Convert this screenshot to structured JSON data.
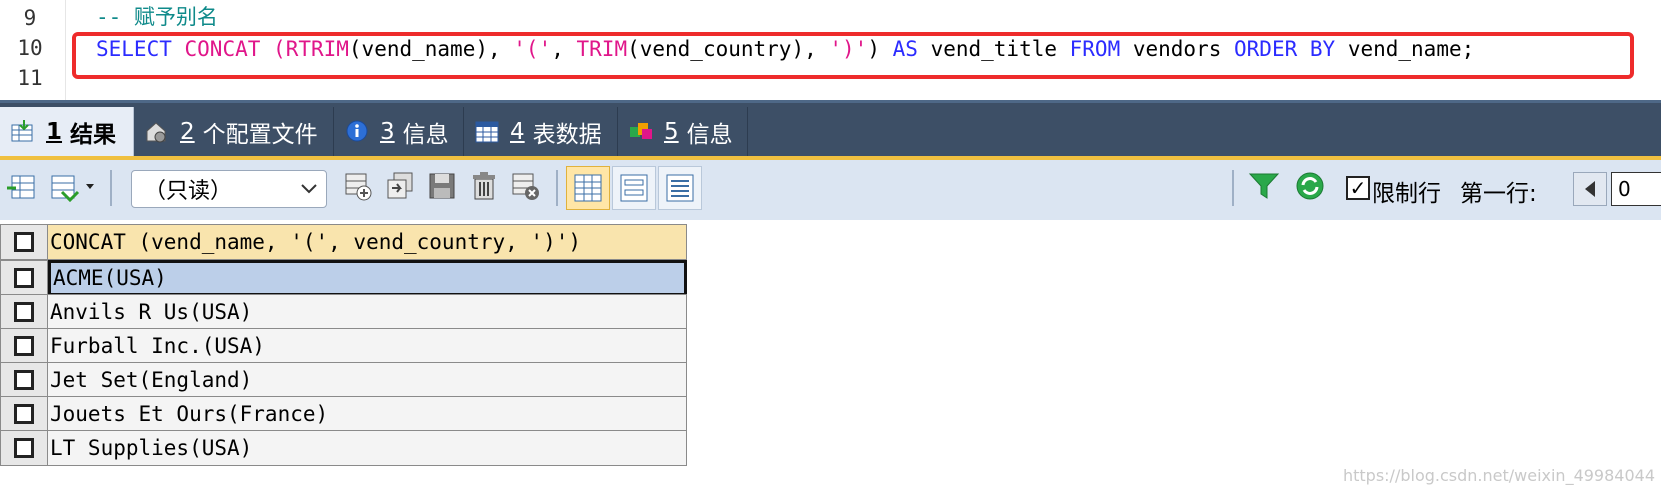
{
  "editor": {
    "line_numbers": [
      "9",
      "10",
      "11"
    ],
    "comment": "-- 赋予别名",
    "tokens": [
      {
        "t": "SELECT",
        "c": "kw"
      },
      {
        "t": " ",
        "c": "plain"
      },
      {
        "t": "CONCAT",
        "c": "fn"
      },
      {
        "t": " ",
        "c": "plain"
      },
      {
        "t": "(",
        "c": "str"
      },
      {
        "t": "RTRIM",
        "c": "fn"
      },
      {
        "t": "(vend_name), ",
        "c": "plain"
      },
      {
        "t": "'('",
        "c": "str"
      },
      {
        "t": ", ",
        "c": "plain"
      },
      {
        "t": "TRIM",
        "c": "fn"
      },
      {
        "t": "(vend_country), ",
        "c": "plain"
      },
      {
        "t": "')'",
        "c": "str"
      },
      {
        "t": ") ",
        "c": "plain"
      },
      {
        "t": "AS",
        "c": "kw"
      },
      {
        "t": " vend_title ",
        "c": "plain"
      },
      {
        "t": "FROM",
        "c": "kw"
      },
      {
        "t": " vendors ",
        "c": "plain"
      },
      {
        "t": "ORDER BY",
        "c": "kw"
      },
      {
        "t": " vend_name;",
        "c": "plain"
      }
    ],
    "highlight_color": "#ee2b2b"
  },
  "tabs": [
    {
      "num": "1",
      "label": "结果",
      "icon": "result-grid-icon",
      "active": true
    },
    {
      "num": "2",
      "label": "个配置文件",
      "icon": "profile-icon",
      "active": false
    },
    {
      "num": "3",
      "label": "信息",
      "icon": "info-icon",
      "active": false
    },
    {
      "num": "4",
      "label": "表数据",
      "icon": "table-data-icon",
      "active": false
    },
    {
      "num": "5",
      "label": "信息",
      "icon": "info-color-icon",
      "active": false
    }
  ],
  "toolbar": {
    "readonly_value": "（只读）",
    "limit_rows_label": "限制行",
    "limit_rows_checked": true,
    "first_row_label": "第一行:",
    "first_row_value": "0"
  },
  "results": {
    "column": "CONCAT (vend_name, '(', vend_country, ')')",
    "rows": [
      "ACME(USA)",
      "Anvils R Us(USA)",
      "Furball Inc.(USA)",
      "Jet Set(England)",
      "Jouets Et Ours(France)",
      "LT Supplies(USA)"
    ],
    "selected_index": 0
  },
  "watermark": "https://blog.csdn.net/weixin_49984044"
}
